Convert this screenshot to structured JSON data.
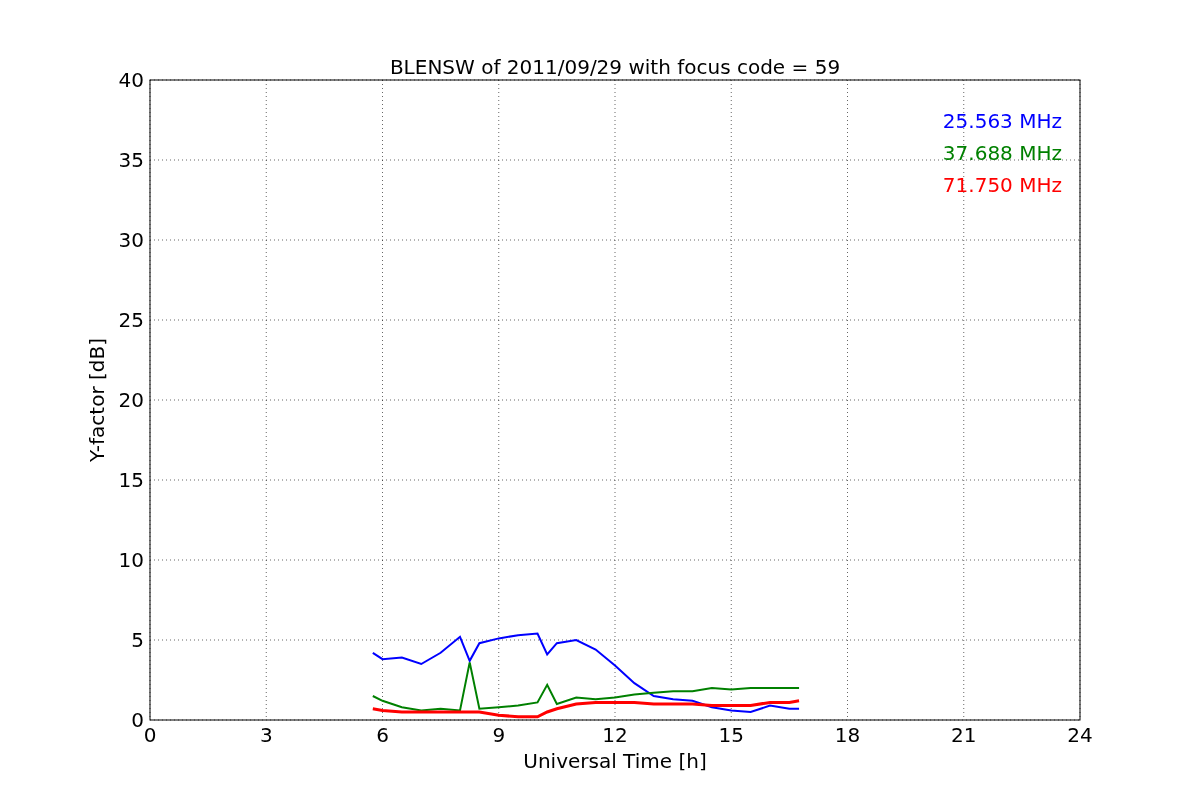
{
  "chart_data": {
    "type": "line",
    "title": "BLENSW of 2011/09/29 with focus code = 59",
    "xlabel": "Universal Time [h]",
    "ylabel": "Y-factor [dB]",
    "x": [
      5.75,
      6,
      6.5,
      7,
      7.5,
      8,
      8.25,
      8.5,
      9,
      9.5,
      10,
      10.25,
      10.5,
      11,
      11.5,
      12,
      12.5,
      13,
      13.5,
      14,
      14.5,
      15,
      15.5,
      16,
      16.5,
      16.75
    ],
    "series": [
      {
        "name": "25.563 MHz",
        "color": "#0000ff",
        "values": [
          4.2,
          3.8,
          3.9,
          3.5,
          4.2,
          5.2,
          3.7,
          4.8,
          5.1,
          5.3,
          5.4,
          4.1,
          4.8,
          5.0,
          4.4,
          3.4,
          2.3,
          1.5,
          1.3,
          1.2,
          0.8,
          0.6,
          0.5,
          0.9,
          0.7,
          0.7
        ]
      },
      {
        "name": "37.688 MHz",
        "color": "#008000",
        "values": [
          1.5,
          1.2,
          0.8,
          0.6,
          0.7,
          0.6,
          3.6,
          0.7,
          0.8,
          0.9,
          1.1,
          2.2,
          1.0,
          1.4,
          1.3,
          1.4,
          1.6,
          1.7,
          1.8,
          1.8,
          2.0,
          1.9,
          2.0,
          2.0,
          2.0,
          2.0
        ]
      },
      {
        "name": "71.750 MHz",
        "color": "#ff0000",
        "values": [
          0.7,
          0.6,
          0.5,
          0.5,
          0.5,
          0.5,
          0.5,
          0.5,
          0.3,
          0.2,
          0.2,
          0.5,
          0.7,
          1.0,
          1.1,
          1.1,
          1.1,
          1.0,
          1.0,
          1.0,
          0.9,
          0.9,
          0.9,
          1.1,
          1.1,
          1.2
        ]
      }
    ],
    "xlim": [
      0,
      24
    ],
    "ylim": [
      0,
      40
    ],
    "xticks": [
      0,
      3,
      6,
      9,
      12,
      15,
      18,
      21,
      24
    ],
    "yticks": [
      0,
      5,
      10,
      15,
      20,
      25,
      30,
      35,
      40
    ],
    "grid": true
  }
}
